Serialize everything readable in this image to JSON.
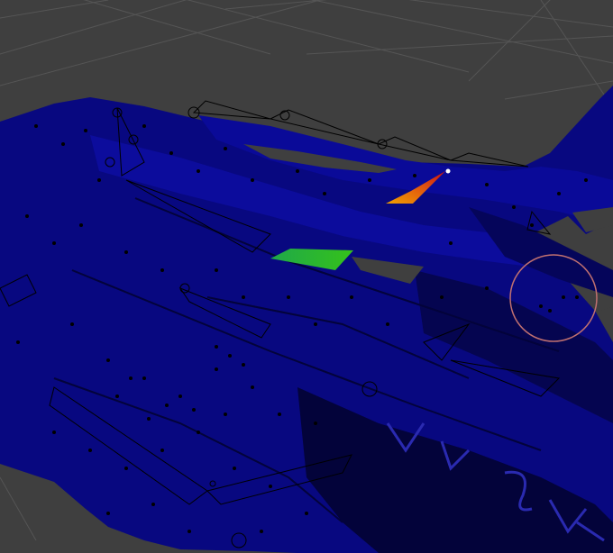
{
  "viewport": {
    "background": "#3f3f3f",
    "grid_color": "#555555",
    "mesh_base_color": "#080880",
    "mesh_dark_color": "#020230",
    "weight_gradient_colors": [
      "#1fa84a",
      "#35c21a",
      "#f0a000",
      "#e05010",
      "#c81010"
    ],
    "brush_circle_color": "#c07070",
    "armature_color": "#000000"
  },
  "tool": {
    "mode": "weight-paint",
    "brush_icon": "brush-circle-icon"
  }
}
